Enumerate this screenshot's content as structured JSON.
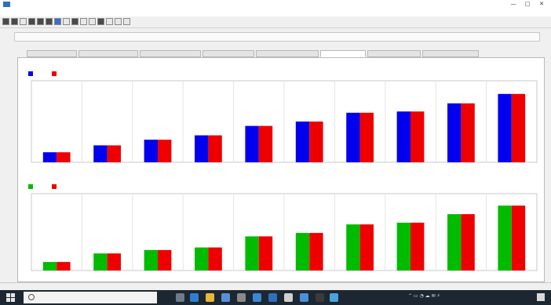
{
  "window": {
    "title": "",
    "min": "—",
    "max": "□",
    "close": "✕"
  },
  "menu": [],
  "toolbar_buttons": [
    "dark",
    "dark",
    "plain",
    "dark",
    "dark",
    "dark",
    "blue",
    "plain",
    "dark",
    "plain",
    "plain",
    "dark",
    "plain",
    "plain",
    "plain"
  ],
  "topbar": [],
  "small_label": "",
  "tabs": [
    {
      "label": "",
      "active": false
    },
    {
      "label": "",
      "active": false
    },
    {
      "label": "",
      "active": false
    },
    {
      "label": "",
      "active": false
    },
    {
      "label": "",
      "active": false
    },
    {
      "label": "",
      "active": true
    },
    {
      "label": "",
      "active": false
    },
    {
      "label": "",
      "active": false
    }
  ],
  "chart_data": [
    {
      "type": "bar",
      "title": "",
      "categories": [
        "",
        "",
        "",
        "",
        "",
        "",
        "",
        "",
        "",
        ""
      ],
      "series": [
        {
          "color": "#0000ee",
          "values": [
            16,
            27,
            36,
            43,
            58,
            65,
            79,
            81,
            94,
            109
          ]
        },
        {
          "color": "#ee0000",
          "values": [
            16,
            27,
            36,
            43,
            58,
            65,
            79,
            81,
            94,
            109
          ]
        }
      ],
      "ylim": [
        0,
        130
      ],
      "yticks": [],
      "grid": true,
      "legend": "top-left"
    },
    {
      "type": "bar",
      "title": "",
      "categories": [
        "",
        "",
        "",
        "",
        "",
        "",
        "",
        "",
        "",
        ""
      ],
      "series": [
        {
          "color": "#00bb00",
          "values": [
            10,
            20,
            24,
            27,
            40,
            44,
            54,
            56,
            66,
            76
          ]
        },
        {
          "color": "#ee0000",
          "values": [
            10,
            20,
            24,
            27,
            40,
            44,
            54,
            56,
            66,
            76
          ]
        }
      ],
      "ylim": [
        0,
        90
      ],
      "yticks": [],
      "grid": true,
      "legend": "top-left"
    }
  ],
  "status": [
    "",
    "",
    ""
  ],
  "taskbar": {
    "search_placeholder": "",
    "clock": "",
    "date": "",
    "icons": [
      {
        "name": "task-view-icon",
        "color": "#6b7c8c"
      },
      {
        "name": "edge-icon",
        "color": "#2f7fd1"
      },
      {
        "name": "file-explorer-icon",
        "color": "#e8b63a"
      },
      {
        "name": "store-icon",
        "color": "#5a8fd8"
      },
      {
        "name": "settings-icon",
        "color": "#8a8a8a"
      },
      {
        "name": "mail-icon",
        "color": "#3c86d6"
      },
      {
        "name": "browser-icon",
        "color": "#2f6fbd"
      },
      {
        "name": "app-icon",
        "color": "#d0d0d0"
      },
      {
        "name": "window-icon",
        "color": "#4a90d9"
      },
      {
        "name": "terminal-icon",
        "color": "#3b3b3b"
      },
      {
        "name": "chart-app-icon",
        "color": "#4aa3df"
      }
    ]
  }
}
